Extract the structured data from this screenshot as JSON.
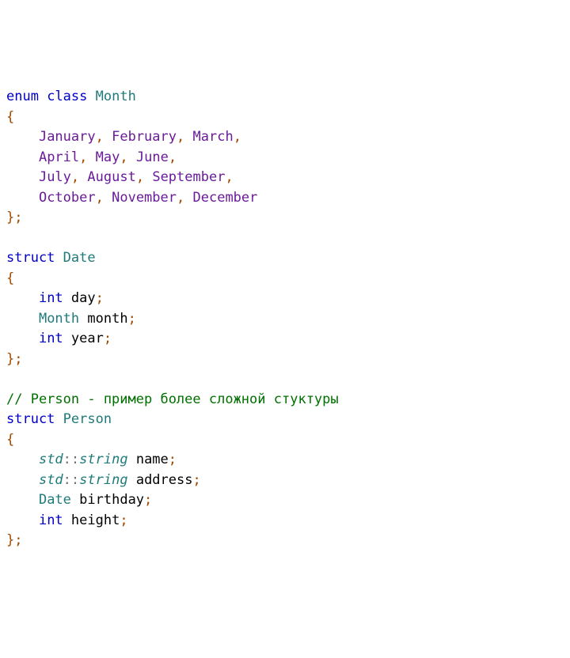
{
  "code": {
    "enum_kw": "enum",
    "class_kw": "class",
    "struct_kw": "struct",
    "int_kw": "int",
    "month_type": "Month",
    "date_type": "Date",
    "person_type": "Person",
    "std_ns": "std",
    "string_type": "string",
    "months": {
      "jan": "January",
      "feb": "February",
      "mar": "March",
      "apr": "April",
      "may": "May",
      "jun": "June",
      "jul": "July",
      "aug": "August",
      "sep": "September",
      "oct": "October",
      "nov": "November",
      "dec": "December"
    },
    "fields": {
      "day": "day",
      "month": "month",
      "year": "year",
      "name": "name",
      "address": "address",
      "birthday": "birthday",
      "height": "height"
    },
    "comment": "// Person - пример более сложной стуктуры",
    "punct": {
      "lbrace": "{",
      "rbrace_semi": "};",
      "comma": ",",
      "semi": ";",
      "dcolon": "::"
    }
  }
}
